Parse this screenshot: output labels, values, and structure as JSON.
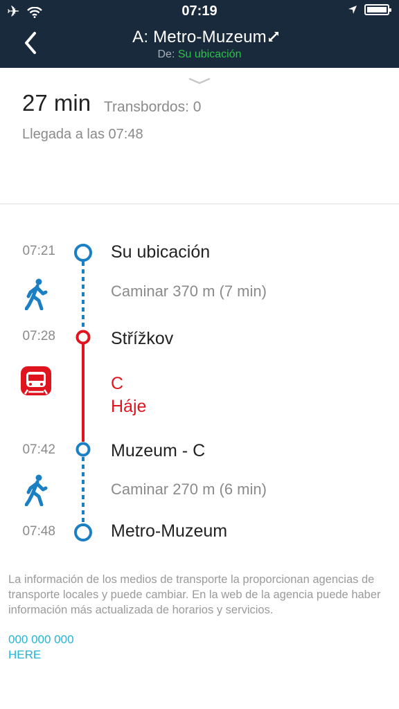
{
  "status_bar": {
    "time": "07:19"
  },
  "header": {
    "title": "A: Metro-Muzeum",
    "from_label": "De:",
    "from_value": "Su ubicación"
  },
  "summary": {
    "duration": "27 min",
    "transfers": "Transbordos: 0",
    "arrival": "Llegada a las 07:48"
  },
  "route": {
    "stops": [
      {
        "time": "07:21",
        "name": "Su ubicación"
      },
      {
        "time": "07:28",
        "name": "Střížkov"
      },
      {
        "time": "07:42",
        "name": "Muzeum - C"
      },
      {
        "time": "07:48",
        "name": "Metro-Muzeum"
      }
    ],
    "walk1": "Caminar 370 m (7 min)",
    "transit_line": "C",
    "transit_direction": "Háje",
    "walk2": "Caminar 270 m (6 min)"
  },
  "footer": {
    "disclaimer": "La información de los medios de transporte la proporcionan agencias de transporte locales y puede cambiar. En la web de la agencia puede haber información más actualizada de horarios y servicios.",
    "phone": "000 000 000",
    "provider": "HERE"
  },
  "colors": {
    "header_bg": "#1a2a3d",
    "walk_blue": "#1b7fc4",
    "metro_red": "#e0141e",
    "link": "#22b4d6",
    "from_green": "#2ec24a"
  }
}
